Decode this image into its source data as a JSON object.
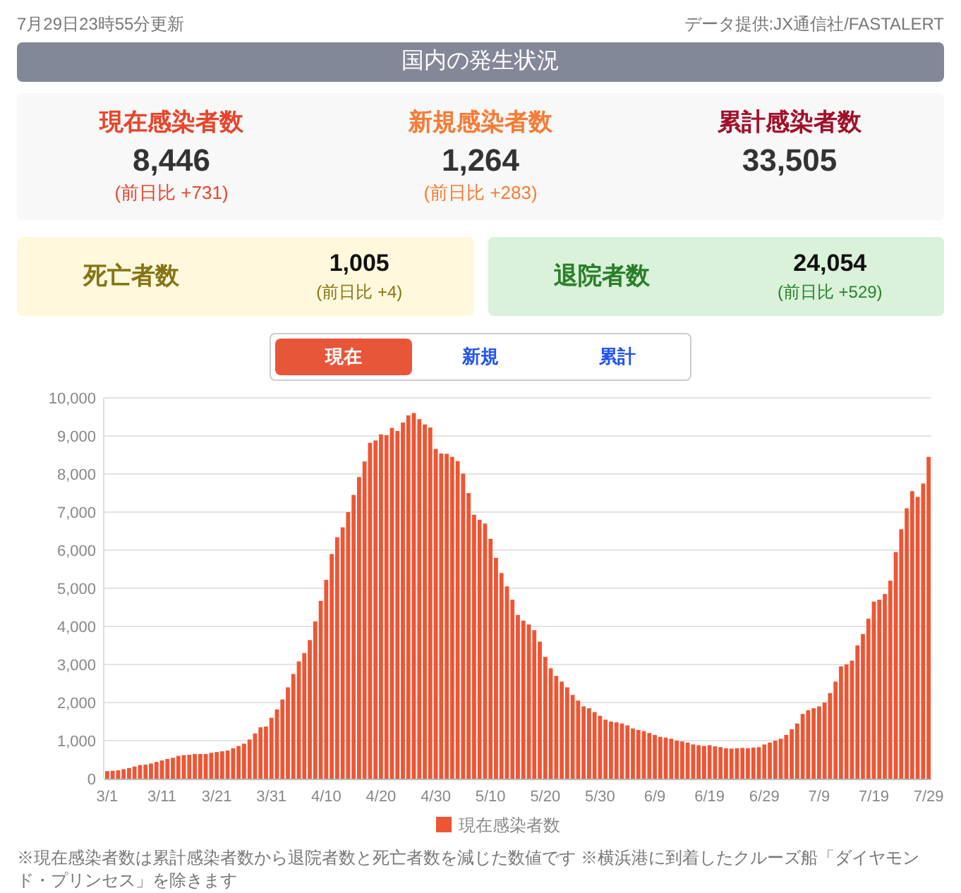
{
  "header": {
    "updated": "7月29日23時55分更新",
    "source": "データ提供:JX通信社/FASTALERT"
  },
  "title": "国内の発生状況",
  "summary": [
    {
      "label": "現在感染者数",
      "value": "8,446",
      "delta": "(前日比 +731)",
      "color": "#e8452c"
    },
    {
      "label": "新規感染者数",
      "value": "1,264",
      "delta": "(前日比 +283)",
      "color": "#f77b35"
    },
    {
      "label": "累計感染者数",
      "value": "33,505",
      "color": "#a0102a"
    }
  ],
  "outcomes": [
    {
      "kind": "deaths",
      "label": "死亡者数",
      "value": "1,005",
      "delta": "(前日比 +4)"
    },
    {
      "kind": "recovered",
      "label": "退院者数",
      "value": "24,054",
      "delta": "(前日比 +529)"
    }
  ],
  "tabs": [
    {
      "label": "現在",
      "selected": true
    },
    {
      "label": "新規",
      "selected": false
    },
    {
      "label": "累計",
      "selected": false
    }
  ],
  "chart": {
    "chart_data": {
      "type": "bar",
      "ylim": [
        0,
        10000
      ],
      "yticks": [
        {
          "value": 0,
          "label": "0"
        },
        {
          "value": 1000,
          "label": "1,000"
        },
        {
          "value": 2000,
          "label": "2,000"
        },
        {
          "value": 3000,
          "label": "3,000"
        },
        {
          "value": 4000,
          "label": "4,000"
        },
        {
          "value": 5000,
          "label": "5,000"
        },
        {
          "value": 6000,
          "label": "6,000"
        },
        {
          "value": 7000,
          "label": "7,000"
        },
        {
          "value": 8000,
          "label": "8,000"
        },
        {
          "value": 9000,
          "label": "9,000"
        },
        {
          "value": 10000,
          "label": "10,000"
        }
      ],
      "grid": true,
      "categories": [
        "3/1",
        null,
        null,
        null,
        null,
        null,
        null,
        null,
        null,
        null,
        "3/11",
        null,
        null,
        null,
        null,
        null,
        null,
        null,
        null,
        null,
        "3/21",
        null,
        null,
        null,
        null,
        null,
        null,
        null,
        null,
        null,
        "3/31",
        null,
        null,
        null,
        null,
        null,
        null,
        null,
        null,
        null,
        "4/10",
        null,
        null,
        null,
        null,
        null,
        null,
        null,
        null,
        null,
        "4/20",
        null,
        null,
        null,
        null,
        null,
        null,
        null,
        null,
        null,
        "4/30",
        null,
        null,
        null,
        null,
        null,
        null,
        null,
        null,
        null,
        "5/10",
        null,
        null,
        null,
        null,
        null,
        null,
        null,
        null,
        null,
        "5/20",
        null,
        null,
        null,
        null,
        null,
        null,
        null,
        null,
        null,
        "5/30",
        null,
        null,
        null,
        null,
        null,
        null,
        null,
        null,
        null,
        "6/9",
        null,
        null,
        null,
        null,
        null,
        null,
        null,
        null,
        null,
        "6/19",
        null,
        null,
        null,
        null,
        null,
        null,
        null,
        null,
        null,
        "6/29",
        null,
        null,
        null,
        null,
        null,
        null,
        null,
        null,
        null,
        "7/9",
        null,
        null,
        null,
        null,
        null,
        null,
        null,
        null,
        null,
        "7/19",
        null,
        null,
        null,
        null,
        null,
        null,
        null,
        null,
        null,
        "7/29"
      ],
      "series": [
        {
          "name": "現在感染者数",
          "color": "#ee5533",
          "values": [
            200,
            210,
            220,
            250,
            280,
            320,
            360,
            370,
            400,
            440,
            480,
            520,
            550,
            600,
            620,
            630,
            650,
            650,
            650,
            680,
            700,
            720,
            740,
            800,
            860,
            920,
            1030,
            1190,
            1350,
            1370,
            1600,
            1820,
            2080,
            2400,
            2750,
            3080,
            3300,
            3640,
            4130,
            4670,
            5220,
            5900,
            6340,
            6600,
            7000,
            7450,
            7920,
            8330,
            8820,
            8880,
            9040,
            9020,
            9210,
            9130,
            9350,
            9540,
            9600,
            9440,
            9300,
            9220,
            8660,
            8540,
            8530,
            8450,
            8340,
            8010,
            7500,
            6930,
            6800,
            6700,
            6300,
            5800,
            5400,
            5050,
            4700,
            4300,
            4150,
            4050,
            3900,
            3600,
            3200,
            2900,
            2700,
            2550,
            2400,
            2200,
            2050,
            1900,
            1850,
            1750,
            1650,
            1550,
            1500,
            1480,
            1450,
            1400,
            1320,
            1280,
            1250,
            1200,
            1150,
            1100,
            1080,
            1050,
            1000,
            980,
            950,
            900,
            880,
            860,
            880,
            850,
            830,
            800,
            790,
            800,
            810,
            800,
            820,
            830,
            900,
            950,
            1000,
            1050,
            1150,
            1300,
            1450,
            1700,
            1800,
            1850,
            1900,
            2000,
            2250,
            2550,
            2950,
            3000,
            3100,
            3500,
            3800,
            4200,
            4650,
            4700,
            4850,
            5200,
            5950,
            6550,
            7100,
            7550,
            7400,
            7750,
            8450
          ]
        }
      ]
    }
  },
  "footnote": "※現在感染者数は累計感染者数から退院者数と死亡者数を減じた数値です ※横浜港に到着したクルーズ船「ダイヤモンド・プリンセス」を除きます"
}
